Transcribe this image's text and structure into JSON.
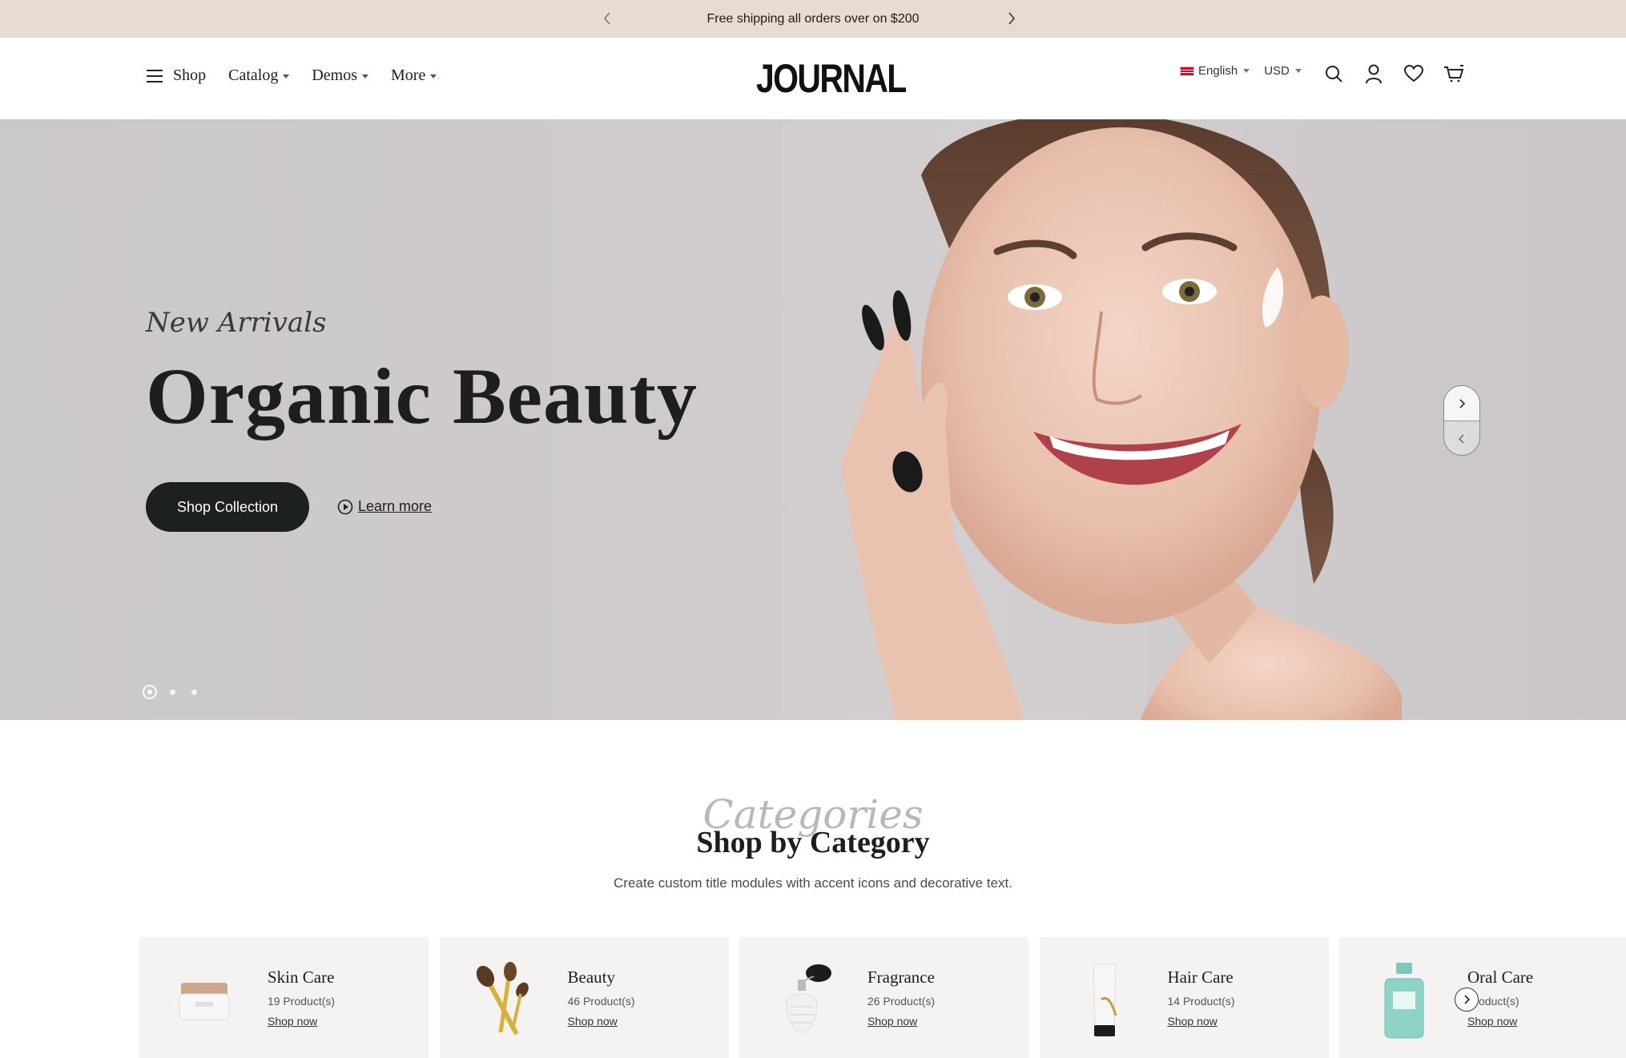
{
  "topbar": {
    "message": "Free shipping all orders over on $200"
  },
  "nav": {
    "shop": "Shop",
    "catalog": "Catalog",
    "demos": "Demos",
    "more": "More"
  },
  "logo": "JOURNAL",
  "header": {
    "language": "English",
    "currency": "USD"
  },
  "icons": [
    "menu-icon",
    "chevron-left-icon",
    "chevron-right-icon",
    "search-icon",
    "account-icon",
    "heart-icon",
    "cart-icon",
    "play-circle-icon"
  ],
  "hero": {
    "script": "New Arrivals",
    "title": "Organic Beauty",
    "primary_button": "Shop Collection",
    "secondary_link": "Learn more",
    "slide_count": 3,
    "active_slide": 1
  },
  "categories": {
    "script": "Categories",
    "title": "Shop by Category",
    "subtitle": "Create custom title modules with accent icons and decorative text.",
    "items": [
      {
        "name": "Skin Care",
        "count": "19 Product(s)",
        "link": "Shop now"
      },
      {
        "name": "Beauty",
        "count": "46 Product(s)",
        "link": "Shop now"
      },
      {
        "name": "Fragrance",
        "count": "26 Product(s)",
        "link": "Shop now"
      },
      {
        "name": "Hair Care",
        "count": "14 Product(s)",
        "link": "Shop now"
      },
      {
        "name": "Oral Care",
        "count": "Product(s)",
        "link": "Shop now"
      }
    ]
  },
  "colors": {
    "topbar_bg": "#e9dbcf",
    "button_dark": "#1c2020",
    "card_bg": "#f4f3f2"
  }
}
